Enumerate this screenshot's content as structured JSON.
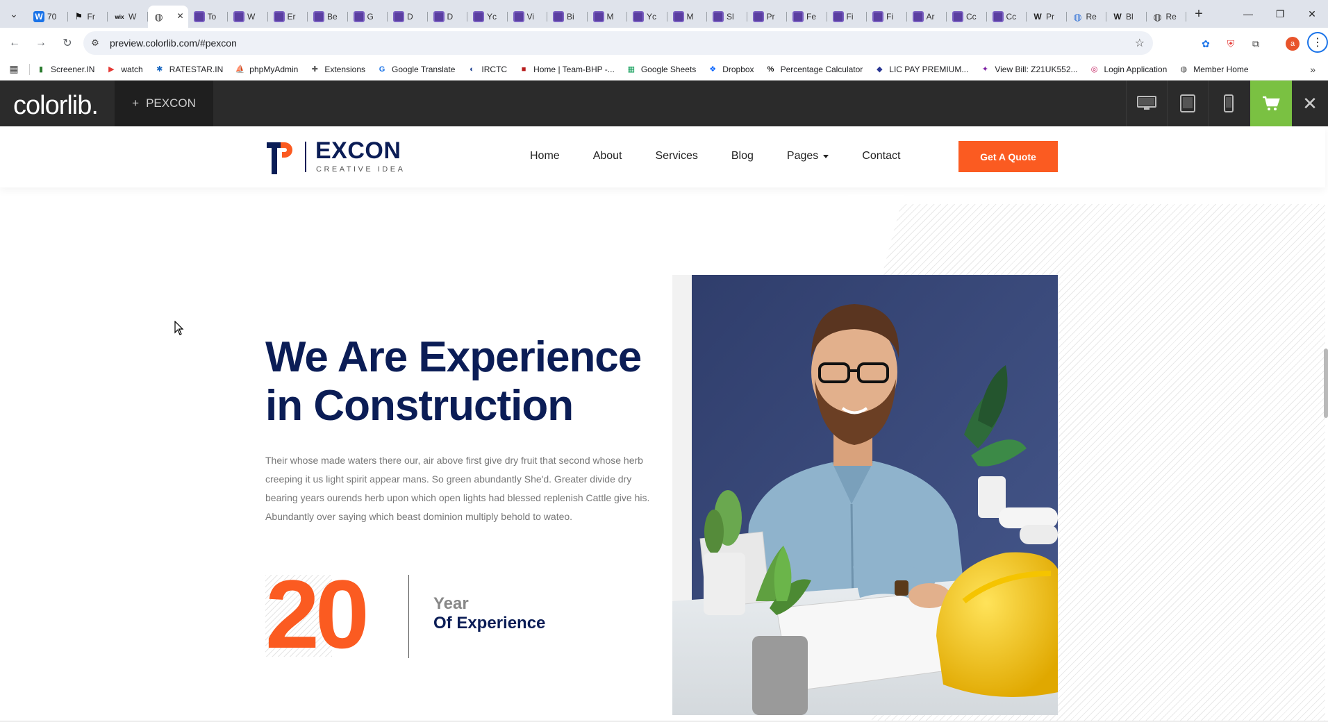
{
  "browser": {
    "tabs": [
      {
        "title": "70",
        "icon": "W",
        "color": "#1a73e8"
      },
      {
        "title": "Fr",
        "icon": "F",
        "color": "#111111"
      },
      {
        "title": "W",
        "icon": "wix",
        "color": "#000000"
      },
      {
        "title": "",
        "icon": "globe",
        "color": "#444444",
        "active": true
      },
      {
        "title": "To",
        "icon": "cl",
        "color": "#5b3fa0"
      },
      {
        "title": "W",
        "icon": "cl",
        "color": "#5b3fa0"
      },
      {
        "title": "Er",
        "icon": "cl",
        "color": "#5b3fa0"
      },
      {
        "title": "Be",
        "icon": "cl",
        "color": "#5b3fa0"
      },
      {
        "title": "G",
        "icon": "cl",
        "color": "#5b3fa0"
      },
      {
        "title": "D",
        "icon": "cl",
        "color": "#5b3fa0"
      },
      {
        "title": "D",
        "icon": "cl",
        "color": "#5b3fa0"
      },
      {
        "title": "Yc",
        "icon": "cl",
        "color": "#5b3fa0"
      },
      {
        "title": "Vi",
        "icon": "cl",
        "color": "#5b3fa0"
      },
      {
        "title": "Bi",
        "icon": "cl",
        "color": "#5b3fa0"
      },
      {
        "title": "M",
        "icon": "cl",
        "color": "#5b3fa0"
      },
      {
        "title": "Yc",
        "icon": "cl",
        "color": "#5b3fa0"
      },
      {
        "title": "M",
        "icon": "cl",
        "color": "#5b3fa0"
      },
      {
        "title": "Sl",
        "icon": "cl",
        "color": "#5b3fa0"
      },
      {
        "title": "Pr",
        "icon": "cl",
        "color": "#5b3fa0"
      },
      {
        "title": "Fe",
        "icon": "cl",
        "color": "#5b3fa0"
      },
      {
        "title": "Fi",
        "icon": "cl",
        "color": "#5b3fa0"
      },
      {
        "title": "Fi",
        "icon": "cl",
        "color": "#5b3fa0"
      },
      {
        "title": "Ar",
        "icon": "cl",
        "color": "#5b3fa0"
      },
      {
        "title": "Cc",
        "icon": "cl",
        "color": "#5b3fa0"
      },
      {
        "title": "Cc",
        "icon": "cl",
        "color": "#5b3fa0"
      },
      {
        "title": "Pr",
        "icon": "W",
        "color": "#222222"
      },
      {
        "title": "Re",
        "icon": "globe",
        "color": "#3f7bd8"
      },
      {
        "title": "Bl",
        "icon": "W",
        "color": "#222222"
      },
      {
        "title": "Re",
        "icon": "globe",
        "color": "#444444"
      }
    ],
    "url": "preview.colorlib.com/#pexcon",
    "profile_initial": "a",
    "bookmarks": [
      {
        "label": "Screener.IN",
        "color": "#2e7d32",
        "glyph": "▮"
      },
      {
        "label": "watch",
        "color": "#e53935",
        "glyph": "▶"
      },
      {
        "label": "RATESTAR.IN",
        "color": "#1565c0",
        "glyph": "✱"
      },
      {
        "label": "phpMyAdmin",
        "color": "#f57c00",
        "glyph": "⛵"
      },
      {
        "label": "Extensions",
        "color": "#555555",
        "glyph": "✚"
      },
      {
        "label": "Google Translate",
        "color": "#1a73e8",
        "glyph": "G"
      },
      {
        "label": "IRCTC",
        "color": "#1a3d8f",
        "glyph": "◐"
      },
      {
        "label": "Home | Team-BHP -...",
        "color": "#b71c1c",
        "glyph": "■"
      },
      {
        "label": "Google Sheets",
        "color": "#0f9d58",
        "glyph": "▦"
      },
      {
        "label": "Dropbox",
        "color": "#0061fe",
        "glyph": "❖"
      },
      {
        "label": "Percentage Calculator",
        "color": "#111111",
        "glyph": "%"
      },
      {
        "label": "LIC PAY PREMIUM...",
        "color": "#283593",
        "glyph": "◆"
      },
      {
        "label": "View Bill: Z21UK552...",
        "color": "#7b1fa2",
        "glyph": "✦"
      },
      {
        "label": "Login Application",
        "color": "#c2185b",
        "glyph": "◎"
      },
      {
        "label": "Member Home",
        "color": "#444444",
        "glyph": "◍"
      }
    ]
  },
  "preview_bar": {
    "logo": "colorlib.",
    "theme_name": "PEXCON"
  },
  "site": {
    "logo_text": "EXCON",
    "logo_sub": "CREATIVE IDEA",
    "nav": [
      "Home",
      "About",
      "Services",
      "Blog",
      "Pages",
      "Contact"
    ],
    "cta": "Get A Quote"
  },
  "hero": {
    "heading_line1": "We Are Experience",
    "heading_line2": "in Construction",
    "paragraph": "Their whose made waters there our, air above first give dry fruit that second whose herb creeping it us light spirit appear mans. So green abundantly She'd. Greater divide dry bearing years ourends herb upon which open lights had blessed replenish Cattle give his. Abundantly over saying which beast dominion multiply behold to wateo.",
    "years": "20",
    "years_label1": "Year",
    "years_label2": "Of Experience"
  },
  "colors": {
    "brand_navy": "#0b1d56",
    "accent_orange": "#fb5b21",
    "cart_green": "#7ac142",
    "previewbar_dark": "#2b2b2b"
  }
}
